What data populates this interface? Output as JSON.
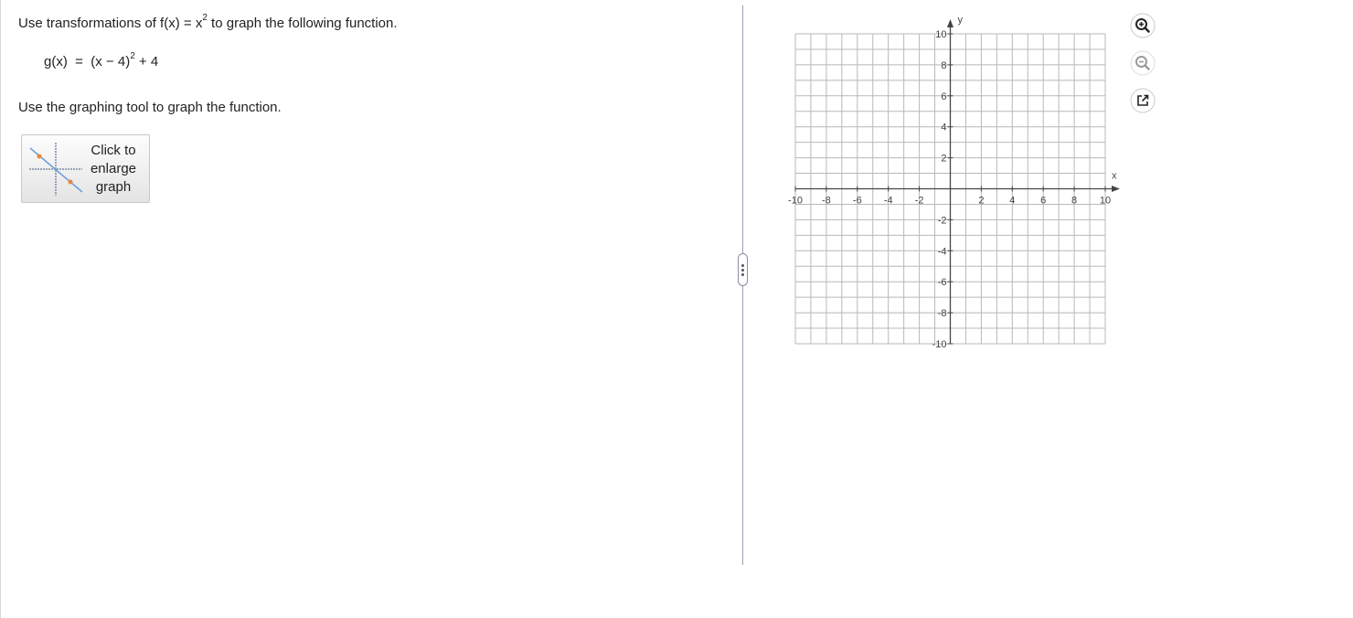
{
  "question": {
    "prompt_before": "Use transformations of f(x) = x",
    "prompt_exp": "2",
    "prompt_after": " to graph the following function.",
    "equation_before": "g(x)  =  (x − 4)",
    "equation_exp": "2",
    "equation_after": " + 4",
    "instruction": "Use the graphing tool to graph the function."
  },
  "enlarge_button": {
    "line1": "Click to",
    "line2": "enlarge",
    "line3": "graph"
  },
  "graph": {
    "x_label": "x",
    "y_label": "y",
    "x_range": [
      -10,
      10
    ],
    "y_range": [
      -10,
      10
    ],
    "grid_step": 1,
    "tick_label_step": 2,
    "x_tick_labels": [
      "-10",
      "-8",
      "-6",
      "-4",
      "-2",
      "2",
      "4",
      "6",
      "8",
      "10"
    ],
    "y_tick_labels": [
      "10",
      "8",
      "6",
      "4",
      "2",
      "-2",
      "-4",
      "-6",
      "-8",
      "-10"
    ]
  },
  "tools": {
    "zoom_in": "zoom-in-icon",
    "zoom_out": "zoom-out-icon",
    "popout": "external-link-icon"
  },
  "colors": {
    "grid": "#b8b8b8",
    "axis": "#444444",
    "tick_label": "#444444",
    "divider": "#9aa0b0"
  }
}
